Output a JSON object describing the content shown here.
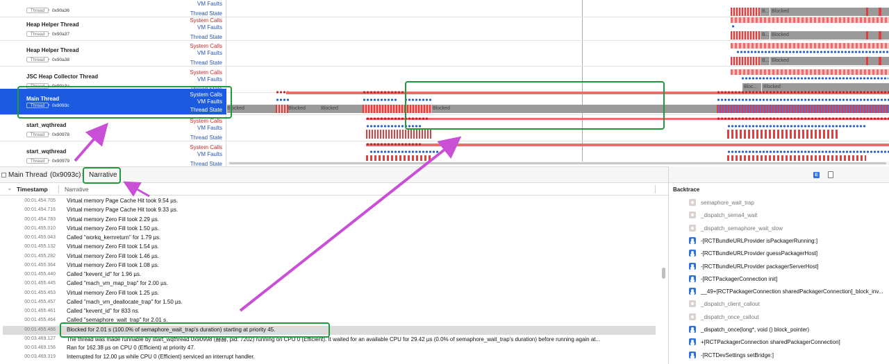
{
  "timeline": {
    "tracks": [
      {
        "name": "",
        "tid_label": "Thread",
        "tid": "0x90a36",
        "selected": false
      },
      {
        "name": "Heap Helper Thread",
        "tid_label": "Thread",
        "tid": "0x90a37",
        "selected": false
      },
      {
        "name": "Heap Helper Thread",
        "tid_label": "Thread",
        "tid": "0x90a38",
        "selected": false
      },
      {
        "name": "JSC Heap Collector Thread",
        "tid_label": "Thread",
        "tid": "0x90a3a",
        "selected": false
      },
      {
        "name": "Main Thread",
        "tid_label": "Thread",
        "tid": "0x9093c",
        "selected": true
      },
      {
        "name": "start_wqthread",
        "tid_label": "Thread",
        "tid": "0x90978",
        "selected": false
      },
      {
        "name": "start_wqthread",
        "tid_label": "Thread",
        "tid": "0x90979",
        "selected": false
      }
    ],
    "lane_labels": {
      "sys": "System Calls",
      "vm": "VM Faults",
      "ts": "Thread State"
    },
    "blocked_label": "Blocked",
    "blocked_short": "B...",
    "blocked_abbrev": "Bloc...",
    "colors": {
      "syscall": "#ec6b6b",
      "syscall_dot": "#b52a2a",
      "vmfault": "#2860c8",
      "blocked": "#9a9a9a",
      "running": "#e23e3e",
      "selected": "#1c5be0",
      "annotation_green": "#1e9a3c",
      "annotation_arrow": "#c94fd6"
    }
  },
  "detail": {
    "thread": "Main Thread",
    "tid": "(0x9093c)",
    "view": "Narrative",
    "columns": {
      "timestamp": "Timestamp",
      "narrative": "Narrative"
    },
    "rows": [
      {
        "ts": "00:01.454.705",
        "text": "Virtual memory Page Cache Hit took 9.54 µs."
      },
      {
        "ts": "00:01.454.716",
        "text": "Virtual memory Page Cache Hit took 9.33 µs."
      },
      {
        "ts": "00:01.454.783",
        "text": "Virtual memory Zero Fill took 2.29 µs."
      },
      {
        "ts": "00:01.455.010",
        "text": "Virtual memory Zero Fill took 1.50 µs."
      },
      {
        "ts": "00:01.455.043",
        "text": "Called \"workq_kernreturn\" for 1.79 µs."
      },
      {
        "ts": "00:01.455.132",
        "text": "Virtual memory Zero Fill took 1.54 µs."
      },
      {
        "ts": "00:01.455.282",
        "text": "Virtual memory Zero Fill took 1.46 µs."
      },
      {
        "ts": "00:01.455.364",
        "text": "Virtual memory Zero Fill took 1.08 µs."
      },
      {
        "ts": "00:01.455.440",
        "text": "Called \"kevent_id\" for 1.96 µs."
      },
      {
        "ts": "00:01.455.445",
        "text": "Called \"mach_vm_map_trap\" for 2.00 µs."
      },
      {
        "ts": "00:01.455.453",
        "text": "Virtual memory Zero Fill took 1.25 µs."
      },
      {
        "ts": "00:01.455.457",
        "text": "Called \"mach_vm_deallocate_trap\" for 1.50 µs."
      },
      {
        "ts": "00:01.455.461",
        "text": "Called \"kevent_id\" for 833 ns."
      },
      {
        "ts": "00:01.455.464",
        "text": "Called \"semaphore_wait_trap\" for 2.01 s."
      },
      {
        "ts": "00:01.455.466",
        "text": "Blocked for 2.01 s (100.0% of semaphore_wait_trap's duration) starting at priority 45.",
        "selected": true
      },
      {
        "ts": "00:03.469.127",
        "text": "The thread was made runnable by start_wqthread  0x90998 (赫赫, pid: 7202) running on CPU 0 (Efficient). It waited for an available CPU for 29.42 µs (0.0% of semaphore_wait_trap's duration) before running again at..."
      },
      {
        "ts": "00:03.469.156",
        "text": "Ran for 162.38 µs on CPU 0 (Efficient) at priority 47."
      },
      {
        "ts": "00:03.469.319",
        "text": "Interrupted for 12.00 µs while CPU 0 (Efficient) serviced an interrupt handler."
      }
    ]
  },
  "inspector": {
    "e_badge": "E",
    "title": "Backtrace",
    "frames": [
      {
        "kind": "sys",
        "text": "semaphore_wait_trap"
      },
      {
        "kind": "sys",
        "text": "_dispatch_sema4_wait"
      },
      {
        "kind": "sys",
        "text": "_dispatch_semaphore_wait_slow"
      },
      {
        "kind": "user",
        "text": "-[RCTBundleURLProvider isPackagerRunning:]"
      },
      {
        "kind": "user",
        "text": "-[RCTBundleURLProvider guessPackagerHost]"
      },
      {
        "kind": "user",
        "text": "-[RCTBundleURLProvider packagerServerHost]"
      },
      {
        "kind": "user",
        "text": "-[RCTPackagerConnection init]"
      },
      {
        "kind": "user",
        "text": "__49+[RCTPackagerConnection sharedPackagerConnection]_block_inv..."
      },
      {
        "kind": "sys",
        "text": "_dispatch_client_callout"
      },
      {
        "kind": "sys",
        "text": "_dispatch_once_callout"
      },
      {
        "kind": "user",
        "text": "_dispatch_once(long*, void () block_pointer)"
      },
      {
        "kind": "user",
        "text": "+[RCTPackagerConnection sharedPackagerConnection]"
      },
      {
        "kind": "user",
        "text": "-[RCTDevSettings setBridge:]"
      }
    ]
  }
}
